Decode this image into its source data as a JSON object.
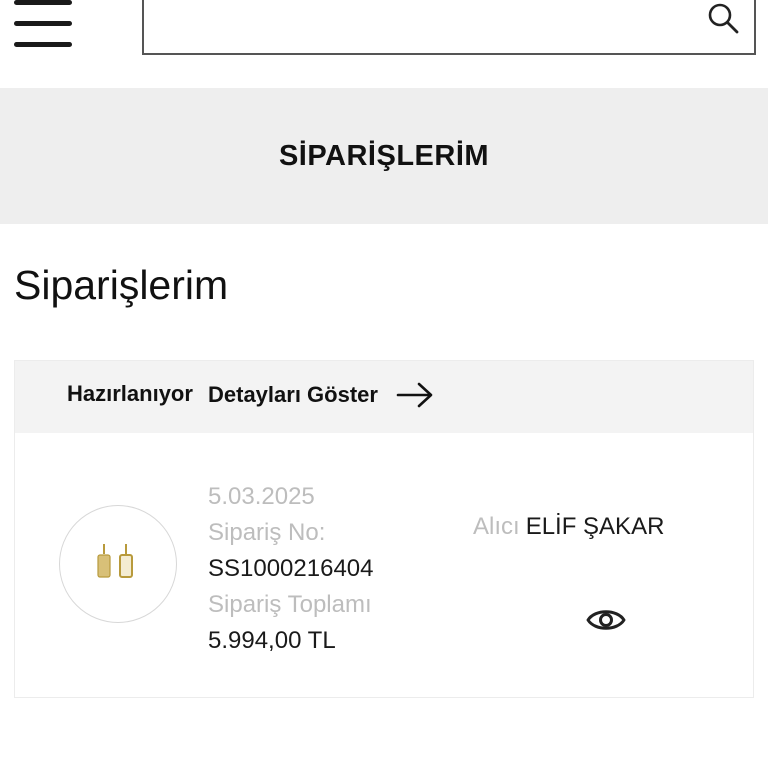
{
  "header": {
    "menu_icon": "hamburger-icon",
    "search": {
      "value": "",
      "placeholder": "",
      "icon": "search-icon"
    }
  },
  "banner": {
    "title": "SİPARİŞLERİM"
  },
  "page": {
    "title": "Siparişlerim"
  },
  "order": {
    "status": "Hazırlanıyor",
    "details_label": "Detayları Göster",
    "details_icon": "arrow-right-icon",
    "date": "5.03.2025",
    "order_no_label": "Sipariş No:",
    "order_no": "SS1000216404",
    "total_label": "Sipariş Toplamı",
    "total": "5.994,00 TL",
    "recipient_label": "Alıcı",
    "recipient_name": "ELİF ŞAKAR",
    "view_icon": "eye-icon",
    "product_image": "earrings-thumbnail"
  },
  "colors": {
    "muted_text": "#bdbdbd",
    "banner_bg": "#eeeeee",
    "card_head_bg": "#f3f3f3",
    "gold": "#c9a94a"
  }
}
